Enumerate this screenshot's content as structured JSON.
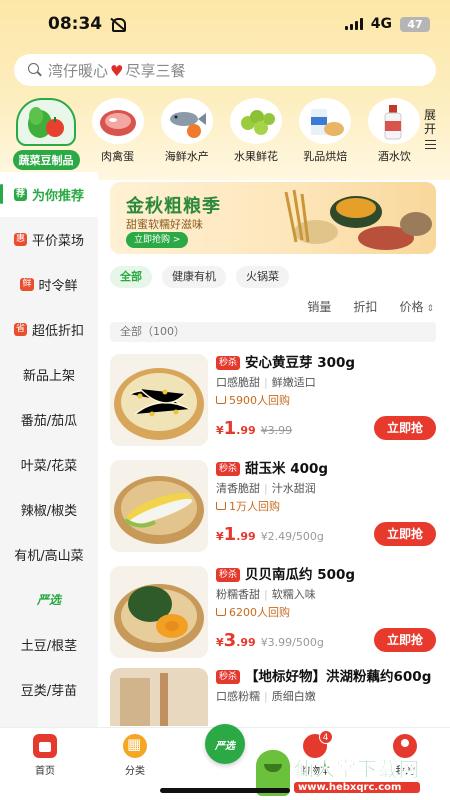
{
  "status": {
    "time": "08:34",
    "network": "4G",
    "battery": "47"
  },
  "search": {
    "prefix": "湾仔暖心",
    "suffix": "尽享三餐"
  },
  "categories": [
    {
      "label": "蔬菜豆制品",
      "active": true
    },
    {
      "label": "肉禽蛋"
    },
    {
      "label": "海鲜水产"
    },
    {
      "label": "水果鲜花"
    },
    {
      "label": "乳品烘焙"
    },
    {
      "label": "酒水饮"
    }
  ],
  "expand": {
    "line1": "展",
    "line2": "开"
  },
  "sidebar": {
    "items": [
      {
        "badge": "荐",
        "label": "为你推荐",
        "active": true
      },
      {
        "badge": "惠",
        "label": "平价菜场"
      },
      {
        "badge": "鲜",
        "label": "时令鲜"
      },
      {
        "badge": "省",
        "label": "超低折扣"
      },
      {
        "label": "新品上架"
      },
      {
        "label": "番茄/茄瓜"
      },
      {
        "label": "叶菜/花菜"
      },
      {
        "label": "辣椒/椒类"
      },
      {
        "label": "有机/高山菜"
      },
      {
        "label": "严选",
        "logo": true
      },
      {
        "label": "土豆/根茎"
      },
      {
        "label": "豆类/芽苗"
      }
    ]
  },
  "banner": {
    "title": "金秋粗粮季",
    "subtitle": "甜蜜软糯好滋味",
    "button": "立即抢购 >"
  },
  "filters": [
    "全部",
    "健康有机",
    "火锅菜"
  ],
  "sort": {
    "sales": "销量",
    "discount": "折扣",
    "price": "价格"
  },
  "all_label": "全部（100）",
  "products": [
    {
      "badge": "秒杀",
      "title": "安心黄豆芽 300g",
      "tag1": "口感脆甜",
      "tag2": "鲜嫩适口",
      "buyers": "5900人回购",
      "price_symbol": "¥",
      "price_int": "1",
      "price_dec": ".99",
      "old_price": "¥3.99",
      "unit_price": "",
      "button": "立即抢"
    },
    {
      "badge": "秒杀",
      "title": "甜玉米 400g",
      "tag1": "清香脆甜",
      "tag2": "汁水甜润",
      "buyers": "1万人回购",
      "price_symbol": "¥",
      "price_int": "1",
      "price_dec": ".99",
      "old_price": "",
      "unit_price": "¥2.49/500g",
      "button": "立即抢"
    },
    {
      "badge": "秒杀",
      "title": "贝贝南瓜约 500g",
      "tag1": "粉糯香甜",
      "tag2": "软糯入味",
      "buyers": "6200人回购",
      "price_symbol": "¥",
      "price_int": "3",
      "price_dec": ".99",
      "old_price": "",
      "unit_price": "¥3.99/500g",
      "button": "立即抢"
    },
    {
      "badge": "秒杀",
      "title": "【地标好物】洪湖粉藕约600g",
      "tag1": "口感粉糯",
      "tag2": "质细白嫩",
      "buyers": "",
      "price_symbol": "",
      "price_int": "",
      "price_dec": "",
      "old_price": "",
      "unit_price": "",
      "button": ""
    }
  ],
  "bottom_nav": [
    {
      "label": "首页"
    },
    {
      "label": "分类"
    },
    {
      "label": "严选"
    },
    {
      "label": "购物车",
      "badge": "4"
    },
    {
      "label": "我的"
    }
  ],
  "yanxuan_logo": "严选",
  "watermark": {
    "title": "仙人掌下载网",
    "url": "www.hebxqrc.com"
  }
}
